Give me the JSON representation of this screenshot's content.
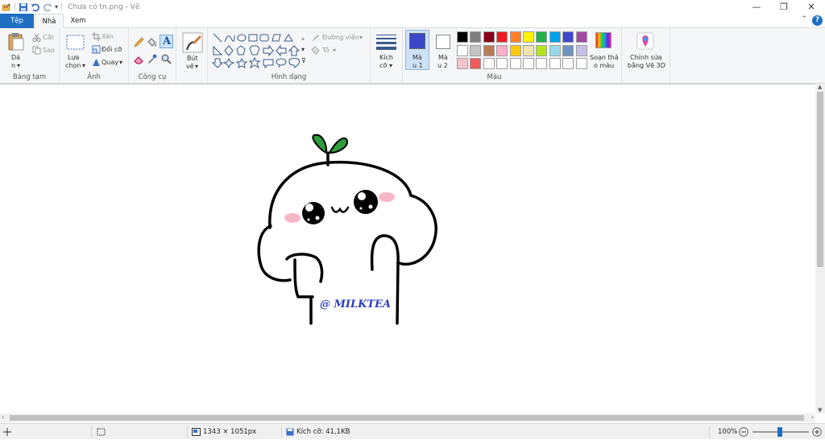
{
  "window": {
    "title": "Chưa có tn.png - Vẽ",
    "controls": [
      "—",
      "❐",
      "✕"
    ]
  },
  "tabs": {
    "file": "Tệp",
    "home": "Nhà",
    "view": "Xem"
  },
  "groups": {
    "clipboard": {
      "paste_1": "Dá",
      "paste_2": "n",
      "cut": "Cắt",
      "copy": "Sao",
      "label": "Bảng tạm"
    },
    "image": {
      "select_1": "Lựa",
      "select_2": "chọn",
      "crop": "Xén",
      "resize": "Đổi cỡ",
      "rotate": "Quay",
      "label": "Ảnh"
    },
    "tools": {
      "label": "Công cụ"
    },
    "brushes": {
      "line1": "Bút",
      "line2": "vẽ"
    },
    "shapes": {
      "outline": "Đường viền",
      "fill": "Tô",
      "label": "Hình dạng"
    },
    "size": {
      "line1": "Kích",
      "line2": "cỡ"
    },
    "colors": {
      "color1_line1": "Mà",
      "color1_line2": "u 1",
      "color2_line1": "Mà",
      "color2_line2": "u 2",
      "edit_line1": "Soạn thả",
      "edit_line2": "o màu",
      "label": "Màu",
      "color1_value": "#3c46c8",
      "color2_value": "#ffffff",
      "palette_row1": [
        "#000000",
        "#7f7f7f",
        "#880015",
        "#ed1c24",
        "#ff7f27",
        "#fff200",
        "#22b14c",
        "#00a2e8",
        "#3f48cc",
        "#a349a4"
      ],
      "palette_row2": [
        "#ffffff",
        "#c3c3c3",
        "#b97a57",
        "#ffaec9",
        "#ffc90e",
        "#efe4b0",
        "#b5e61d",
        "#99d9ea",
        "#7092be",
        "#c8bfe7"
      ],
      "palette_row3": [
        "#f2c4cc",
        "#f05a5a",
        "#ffffff",
        "#ffffff",
        "#ffffff",
        "#ffffff",
        "#ffffff",
        "#ffffff",
        "#ffffff",
        "#ffffff"
      ]
    },
    "paint3d": {
      "line1": "Chỉnh sửa",
      "line2": "bằng Vẽ 3D"
    }
  },
  "drawing": {
    "watermark": "@ MILKTEA",
    "sprout_color": "#2e9e3c",
    "blush_color": "#f7b6c4",
    "watermark_color": "#2b3db8"
  },
  "statusbar": {
    "dimensions": "1343 × 1051px",
    "size": "Kích cỡ: 41,1KB",
    "zoom": "100%"
  }
}
